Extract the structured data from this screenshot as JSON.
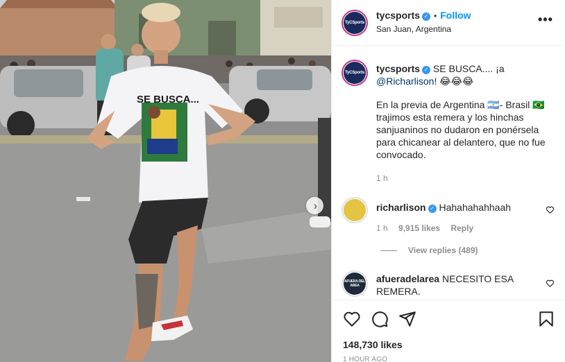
{
  "post": {
    "author": "tycsports",
    "avatar_text": "TyCSports",
    "follow_label": "Follow",
    "location": "San Juan, Argentina",
    "more_label": "•••",
    "next_label": "›"
  },
  "photo": {
    "shirt_text": "SE BUSCA..."
  },
  "caption": {
    "author": "tycsports",
    "headline": "SE BUSCA.... ¡a",
    "mention": "@Richarlison!",
    "emojis": "😂😂😂",
    "body": "En la previa de Argentina 🇦🇷- Brasil 🇧🇷 trajimos esta remera y los hinchas sanjuaninos no dudaron en ponérsela para chicanear al delantero, que no fue convocado.",
    "time": "1 h"
  },
  "comments": [
    {
      "user": "richarlison",
      "text": "Hahahahahhaah",
      "time": "1 h",
      "likes": "9,915 likes",
      "reply_label": "Reply",
      "view_replies": "View replies (489)"
    },
    {
      "user": "afueradelarea",
      "avatar_text": "AFUERA DEL AREA",
      "text": "NECESITO ESA REMERA."
    }
  ],
  "actions": {
    "likes": "148,730 likes",
    "time_ago": "1 HOUR AGO"
  },
  "colors": {
    "link": "#0095f6",
    "mention": "#00376b",
    "muted": "#8e8e8e",
    "verified": "#3897f0"
  },
  "icons": [
    "verified-badge-icon",
    "heart-icon",
    "comment-icon",
    "share-icon",
    "bookmark-icon",
    "chevron-right-icon",
    "more-options-icon"
  ]
}
